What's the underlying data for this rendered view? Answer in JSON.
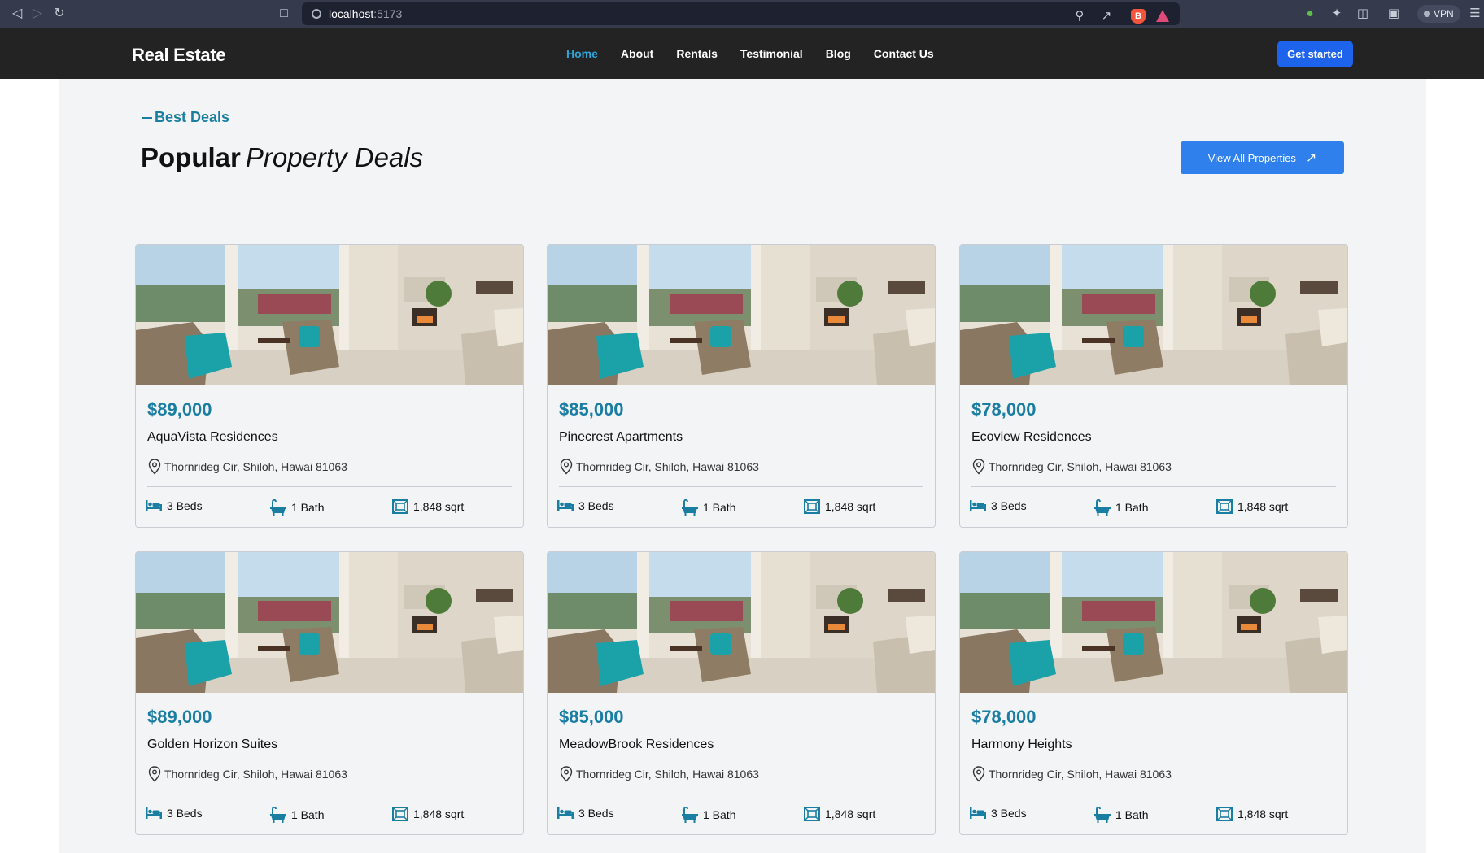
{
  "browser": {
    "url_host": "localhost",
    "url_port": ":5173",
    "vpn_label": "VPN"
  },
  "header": {
    "logo": "Real Estate",
    "nav": [
      {
        "label": "Home",
        "active": true
      },
      {
        "label": "About",
        "active": false
      },
      {
        "label": "Rentals",
        "active": false
      },
      {
        "label": "Testimonial",
        "active": false
      },
      {
        "label": "Blog",
        "active": false
      },
      {
        "label": "Contact Us",
        "active": false
      }
    ],
    "cta_label": "Get started"
  },
  "section": {
    "eyebrow": "Best Deals",
    "heading_strong": "Popular",
    "heading_italic": "Property Deals",
    "view_all_label": "View All Properties"
  },
  "listings": [
    {
      "price": "$89,000",
      "name": "AquaVista Residences",
      "address": "Thornrideg Cir, Shiloh, Hawai 81063",
      "beds": "3  Beds",
      "baths": "1  Bath",
      "area": "1,848  sqrt"
    },
    {
      "price": "$85,000",
      "name": "Pinecrest Apartments",
      "address": "Thornrideg Cir, Shiloh, Hawai 81063",
      "beds": "3  Beds",
      "baths": "1  Bath",
      "area": "1,848  sqrt"
    },
    {
      "price": "$78,000",
      "name": "Ecoview Residences",
      "address": "Thornrideg Cir, Shiloh, Hawai 81063",
      "beds": "3  Beds",
      "baths": "1  Bath",
      "area": "1,848  sqrt"
    },
    {
      "price": "$89,000",
      "name": "Golden Horizon Suites",
      "address": "Thornrideg Cir, Shiloh, Hawai 81063",
      "beds": "3  Beds",
      "baths": "1  Bath",
      "area": "1,848  sqrt"
    },
    {
      "price": "$85,000",
      "name": "MeadowBrook Residences",
      "address": "Thornrideg Cir, Shiloh, Hawai 81063",
      "beds": "3  Beds",
      "baths": "1  Bath",
      "area": "1,848  sqrt"
    },
    {
      "price": "$78,000",
      "name": "Harmony Heights",
      "address": "Thornrideg Cir, Shiloh, Hawai 81063",
      "beds": "3  Beds",
      "baths": "1  Bath",
      "area": "1,848  sqrt"
    }
  ],
  "colors": {
    "accent_teal": "#1a7ea3",
    "primary_blue": "#1e63ec",
    "header_bg": "#232323",
    "active_nav": "#2fa4d8"
  },
  "icons": {
    "beds": "bed-icon",
    "baths": "bathtub-icon",
    "area": "floor-area-icon",
    "address": "map-pin-icon"
  }
}
